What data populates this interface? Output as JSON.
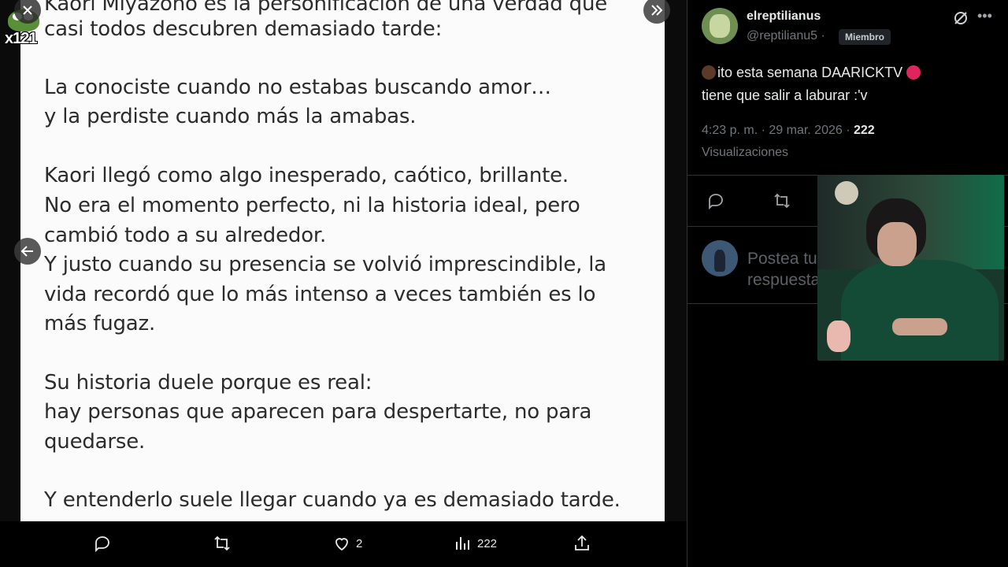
{
  "viewer": {
    "image_lines": [
      "Kaori Miyazono es la personificación de una verdad que",
      "casi todos descubren demasiado tarde:",
      "La conociste cuando no estabas buscando amor…",
      "y la perdiste cuando más la amabas.",
      "Kaori llegó como algo inesperado, caótico, brillante.",
      "No era el momento perfecto, ni la historia ideal, pero",
      "cambió todo a su alrededor.",
      "Y justo cuando su presencia se volvió imprescindible, la",
      "vida recordó que lo más intenso a veces también es lo",
      "más fugaz.",
      "Su historia duele porque es real:",
      "hay personas que aparecen para despertarte, no para",
      "quedarse.",
      "Y entenderlo suele llegar cuando ya es demasiado tarde."
    ],
    "watermark_text": "x121",
    "close_icon": "close-icon",
    "collapse_icon": "double-chevron-right-icon",
    "prev_icon": "arrow-left-icon",
    "actions": {
      "like_count": "2",
      "views_count": "222"
    }
  },
  "tweet": {
    "author_name": "elreptilianus",
    "author_handle": "@reptilianu5 ·",
    "member_badge": "Miembro",
    "text_line1": "ito esta semana DAARICKTV",
    "text_line2": "tiene que salir a laburar :'v",
    "timestamp": "4:23 p. m. · 29 mar. 2026 ·",
    "views": "222",
    "views_label": "Visualizaciones",
    "reply_placeholder": "Postea tu respuesta"
  },
  "colors": {
    "background": "#000000",
    "image_bg": "#fbfbfb",
    "text_primary": "#e7e9ea",
    "text_secondary": "#71767b"
  }
}
